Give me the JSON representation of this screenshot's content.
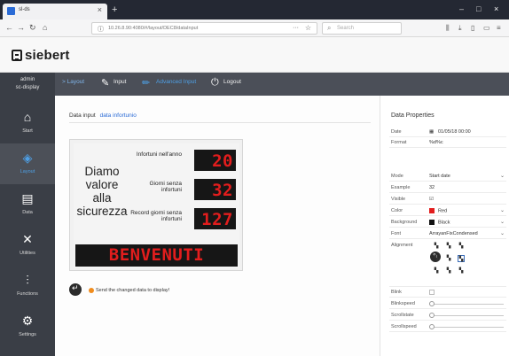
{
  "browser": {
    "tab_title": "sl-ds",
    "tab_close": "×",
    "new_tab": "+",
    "url": "10.26.8.90:4080/#/layout/DEC8/dataInput",
    "search_placeholder": "Search",
    "window_min": "–",
    "window_max": "□",
    "window_close": "×"
  },
  "app": {
    "logo": "siebert",
    "user": {
      "name": "admin",
      "display": "sc-display"
    },
    "topbar": {
      "breadcrumb_arrow": "> Layout",
      "input_label": "Input",
      "properties_label": "Advanced Input",
      "logout_label": "Logout"
    },
    "sidebar": [
      {
        "label": "Start",
        "icon": "home-icon"
      },
      {
        "label": "Layout",
        "icon": "layers-icon",
        "active": true
      },
      {
        "label": "Data",
        "icon": "database-icon"
      },
      {
        "label": "Utilities",
        "icon": "tools-icon"
      },
      {
        "label": "Functions",
        "icon": "sliders-icon"
      },
      {
        "label": "Settings",
        "icon": "gears-icon"
      }
    ]
  },
  "main": {
    "crumb_parent": "Data input",
    "crumb_active": "data infortunio",
    "preview": {
      "slogan": "Diamo valore alla sicurezza",
      "stats": [
        {
          "label": "Infortuni nell'anno",
          "value": "20"
        },
        {
          "label": "Giorni senza infortuni",
          "value": "32"
        },
        {
          "label": "Record giorni senza infortuni",
          "value": "127"
        }
      ],
      "banner": "BENVENUTI"
    },
    "send_text": "Send the changed data to display!"
  },
  "properties": {
    "title": "Data Properties",
    "rows": {
      "date": {
        "label": "Date",
        "value": "01/05/18 00:00"
      },
      "format": {
        "label": "Format",
        "value": "%d%c"
      },
      "mode": {
        "label": "Mode",
        "value": "Start date"
      },
      "example": {
        "label": "Example",
        "value": "32"
      },
      "visible": {
        "label": "Visible",
        "value": ""
      },
      "color": {
        "label": "Color",
        "value": "Red",
        "swatch": "#e21d1d"
      },
      "background": {
        "label": "Background",
        "value": "Black",
        "swatch": "#111111"
      },
      "font": {
        "label": "Font",
        "value": "ArrayanFixCondensed"
      },
      "alignment": {
        "label": "Alignment"
      },
      "blink": {
        "label": "Blink"
      },
      "blinkspeed": {
        "label": "Blinkspeed"
      },
      "scrollstate": {
        "label": "Scrollstate"
      },
      "scrollspeed": {
        "label": "Scrollspeed"
      }
    }
  }
}
